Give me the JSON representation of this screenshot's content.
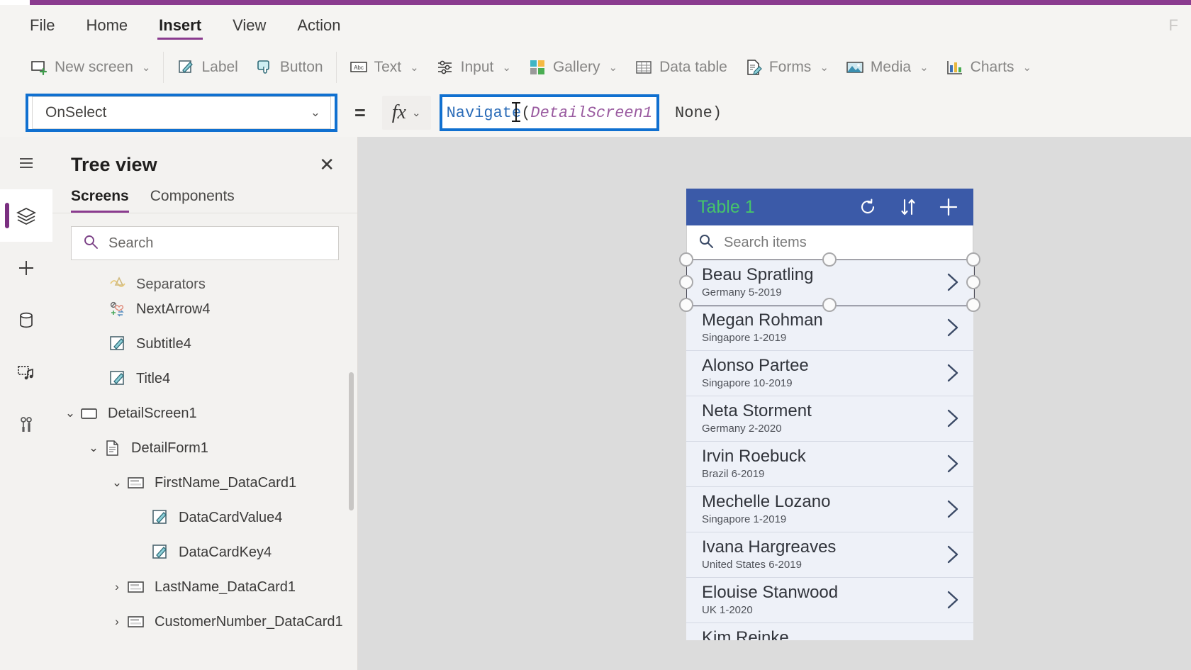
{
  "theme": {
    "accent_purple": "#8a3b8f",
    "selection_blue": "#1070d0",
    "gallery_header_blue": "#3b5aa8",
    "gallery_title_green": "#46c46a",
    "canvas_gray": "#dcdcdc"
  },
  "menubar": {
    "items": [
      {
        "label": "File",
        "active": false
      },
      {
        "label": "Home",
        "active": false
      },
      {
        "label": "Insert",
        "active": true
      },
      {
        "label": "View",
        "active": false
      },
      {
        "label": "Action",
        "active": false
      }
    ],
    "right_label": "F"
  },
  "ribbon": {
    "items": [
      {
        "label": "New screen",
        "icon": "new-screen-icon",
        "caret": true
      },
      {
        "label": "Label",
        "icon": "label-icon",
        "caret": false
      },
      {
        "label": "Button",
        "icon": "button-icon",
        "caret": false
      },
      {
        "label": "Text",
        "icon": "text-icon",
        "caret": true
      },
      {
        "label": "Input",
        "icon": "input-icon",
        "caret": true
      },
      {
        "label": "Gallery",
        "icon": "gallery-icon",
        "caret": true
      },
      {
        "label": "Data table",
        "icon": "data-table-icon",
        "caret": false
      },
      {
        "label": "Forms",
        "icon": "forms-icon",
        "caret": true
      },
      {
        "label": "Media",
        "icon": "media-icon",
        "caret": true
      },
      {
        "label": "Charts",
        "icon": "charts-icon",
        "caret": true
      }
    ]
  },
  "propbar": {
    "property_value": "OnSelect",
    "equals": "=",
    "fx_label": "fx",
    "formula": {
      "function_name": "Navigate",
      "open_paren": "(",
      "argument": "DetailScreen1",
      "tail": "None)"
    }
  },
  "rail": {
    "items": [
      {
        "name": "hamburger-menu-icon",
        "active": false
      },
      {
        "name": "tree-view-icon",
        "active": true
      },
      {
        "name": "insert-plus-icon",
        "active": false
      },
      {
        "name": "data-icon",
        "active": false
      },
      {
        "name": "media-library-icon",
        "active": false
      },
      {
        "name": "advanced-tools-icon",
        "active": false
      }
    ]
  },
  "treeview": {
    "title": "Tree view",
    "close_label": "✕",
    "tabs": [
      {
        "label": "Screens",
        "active": true
      },
      {
        "label": "Components",
        "active": false
      }
    ],
    "search_placeholder": "Search",
    "nodes": [
      {
        "label": "Separators",
        "indent": 2,
        "chevron": "",
        "icon": "separators-icon",
        "clipped": true
      },
      {
        "label": "NextArrow4",
        "indent": 2,
        "chevron": "",
        "icon": "icon-control-icon",
        "clipped": false
      },
      {
        "label": "Subtitle4",
        "indent": 2,
        "chevron": "",
        "icon": "label-node-icon",
        "clipped": false
      },
      {
        "label": "Title4",
        "indent": 2,
        "chevron": "",
        "icon": "label-node-icon",
        "clipped": false
      },
      {
        "label": "DetailScreen1",
        "indent": 0,
        "chevron": "v",
        "icon": "screen-icon",
        "clipped": false
      },
      {
        "label": "DetailForm1",
        "indent": 1,
        "chevron": "v",
        "icon": "form-icon",
        "clipped": false
      },
      {
        "label": "FirstName_DataCard1",
        "indent": 2,
        "chevron": "v",
        "icon": "datacard-icon",
        "clipped": false
      },
      {
        "label": "DataCardValue4",
        "indent": 3,
        "chevron": "",
        "icon": "label-node-icon",
        "clipped": false
      },
      {
        "label": "DataCardKey4",
        "indent": 3,
        "chevron": "",
        "icon": "label-node-icon",
        "clipped": false
      },
      {
        "label": "LastName_DataCard1",
        "indent": 2,
        "chevron": ">",
        "icon": "datacard-icon",
        "clipped": false
      },
      {
        "label": "CustomerNumber_DataCard1",
        "indent": 2,
        "chevron": ">",
        "icon": "datacard-icon",
        "clipped": false
      }
    ]
  },
  "preview": {
    "gallery_title": "Table 1",
    "header_icons": [
      "refresh-icon",
      "sort-icon",
      "add-icon"
    ],
    "search_placeholder": "Search items",
    "items": [
      {
        "name": "Beau Spratling",
        "sub": "Germany 5-2019",
        "partial": false
      },
      {
        "name": "Megan Rohman",
        "sub": "Singapore 1-2019",
        "partial": false
      },
      {
        "name": "Alonso Partee",
        "sub": "Singapore 10-2019",
        "partial": false
      },
      {
        "name": "Neta Storment",
        "sub": "Germany 2-2020",
        "partial": false
      },
      {
        "name": "Irvin Roebuck",
        "sub": "Brazil 6-2019",
        "partial": false
      },
      {
        "name": "Mechelle Lozano",
        "sub": "Singapore 1-2019",
        "partial": false
      },
      {
        "name": "Ivana Hargreaves",
        "sub": "United States 6-2019",
        "partial": false
      },
      {
        "name": "Elouise Stanwood",
        "sub": "UK 1-2020",
        "partial": false
      },
      {
        "name": "Kim Reinke",
        "sub": "",
        "partial": true
      }
    ]
  }
}
